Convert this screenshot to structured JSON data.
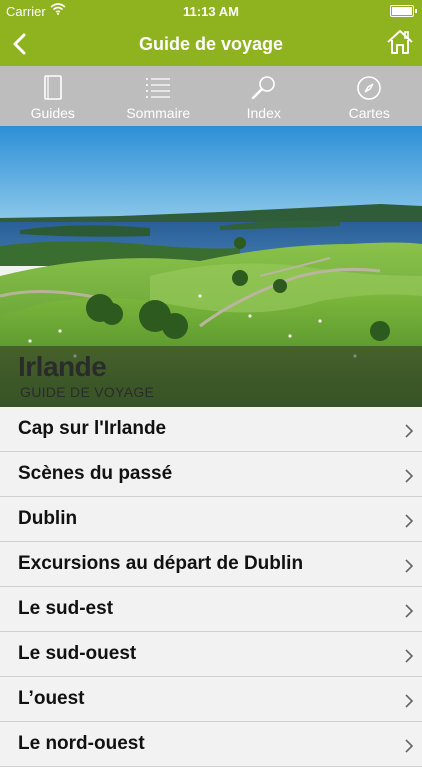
{
  "status_bar": {
    "carrier": "Carrier",
    "time": "11:13 AM"
  },
  "nav": {
    "title": "Guide de voyage"
  },
  "tabs": [
    {
      "label": "Guides",
      "icon": "book-icon"
    },
    {
      "label": "Sommaire",
      "icon": "list-icon"
    },
    {
      "label": "Index",
      "icon": "magnifier-icon"
    },
    {
      "label": "Cartes",
      "icon": "compass-icon"
    }
  ],
  "hero": {
    "title": "Irlande",
    "subtitle": "GUIDE DE VOYAGE"
  },
  "list": [
    "Cap sur l'Irlande",
    "Scènes du passé",
    "Dublin",
    "Excursions au départ de Dublin",
    "Le sud-est",
    "Le sud-ouest",
    "L’ouest",
    "Le nord-ouest"
  ],
  "colors": {
    "brand": "#8fb21f",
    "tabbar": "#bdbdbd",
    "list_bg": "#f2f2f2"
  }
}
